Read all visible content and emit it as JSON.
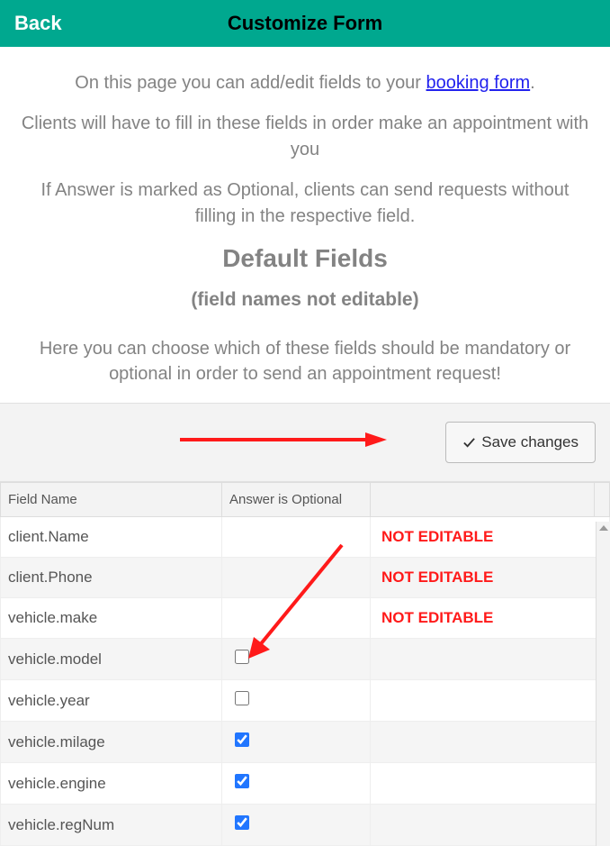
{
  "header": {
    "back": "Back",
    "title": "Customize Form"
  },
  "intro": {
    "line1_pre": "On this page you can add/edit fields to your ",
    "line1_link": "booking form",
    "line1_post": ".",
    "line2": "Clients will have to fill in these fields in order make an appointment with you",
    "line3": "If Answer is marked as Optional, clients can send requests without filling in the respective field."
  },
  "section": {
    "title": "Default Fields",
    "subtitle": "(field names not editable)",
    "desc": "Here you can choose which of these fields should be mandatory or optional in order to send an appointment request!"
  },
  "toolbar": {
    "save_label": "Save changes"
  },
  "table": {
    "headers": {
      "name": "Field Name",
      "optional": "Answer is Optional",
      "status": ""
    },
    "rows": [
      {
        "name": "client.Name",
        "optional": null,
        "status": "NOT EDITABLE"
      },
      {
        "name": "client.Phone",
        "optional": null,
        "status": "NOT EDITABLE"
      },
      {
        "name": "vehicle.make",
        "optional": null,
        "status": "NOT EDITABLE"
      },
      {
        "name": "vehicle.model",
        "optional": false,
        "status": ""
      },
      {
        "name": "vehicle.year",
        "optional": false,
        "status": ""
      },
      {
        "name": "vehicle.milage",
        "optional": true,
        "status": ""
      },
      {
        "name": "vehicle.engine",
        "optional": true,
        "status": ""
      },
      {
        "name": "vehicle.regNum",
        "optional": true,
        "status": ""
      }
    ]
  }
}
